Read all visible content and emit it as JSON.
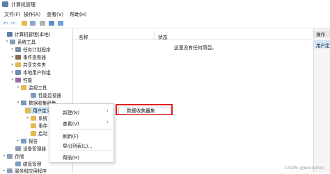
{
  "window": {
    "title": "计算机管理"
  },
  "menu": {
    "items": [
      "文件(F)",
      "操作(A)",
      "查看(V)",
      "帮助(H)"
    ]
  },
  "tree": {
    "nodes": [
      {
        "label": "计算机管理(本地)",
        "toggle": ""
      },
      {
        "label": "系统工具",
        "toggle": "▾"
      },
      {
        "label": "任务计划程序",
        "toggle": "▸"
      },
      {
        "label": "事件查看器",
        "toggle": "▸"
      },
      {
        "label": "共享文件夹",
        "toggle": "▸"
      },
      {
        "label": "本地用户和组",
        "toggle": "▸"
      },
      {
        "label": "性能",
        "toggle": "▾"
      },
      {
        "label": "监视工具",
        "toggle": "▾"
      },
      {
        "label": "性能监视器",
        "toggle": ""
      },
      {
        "label": "数据收集器集",
        "toggle": "▾"
      },
      {
        "label": "用户定义",
        "toggle": ""
      },
      {
        "label": "系统",
        "toggle": "▸"
      },
      {
        "label": "事件",
        "toggle": ""
      },
      {
        "label": "启动",
        "toggle": ""
      },
      {
        "label": "报告",
        "toggle": "▸"
      },
      {
        "label": "设备管理器",
        "toggle": ""
      },
      {
        "label": "存储",
        "toggle": "▾"
      },
      {
        "label": "磁盘管理",
        "toggle": ""
      },
      {
        "label": "服务和应用程序",
        "toggle": "▸"
      }
    ]
  },
  "content": {
    "col_name": "名称",
    "col_status": "状态",
    "empty_message": "这里没有任何项目。"
  },
  "actions": {
    "header": "操作",
    "subheader": "用户定义"
  },
  "context_menu": {
    "items": [
      {
        "label": "新建(N)",
        "arrow": "›"
      },
      {
        "label": "查看(V)",
        "arrow": "›"
      },
      {
        "label": "刷新(F)",
        "arrow": ""
      },
      {
        "label": "导出列表(L)...",
        "arrow": ""
      },
      {
        "label": "帮助(H)",
        "arrow": ""
      }
    ]
  },
  "submenu": {
    "label": "数据收集器集"
  },
  "watermark": "CSDN @weixpfen"
}
